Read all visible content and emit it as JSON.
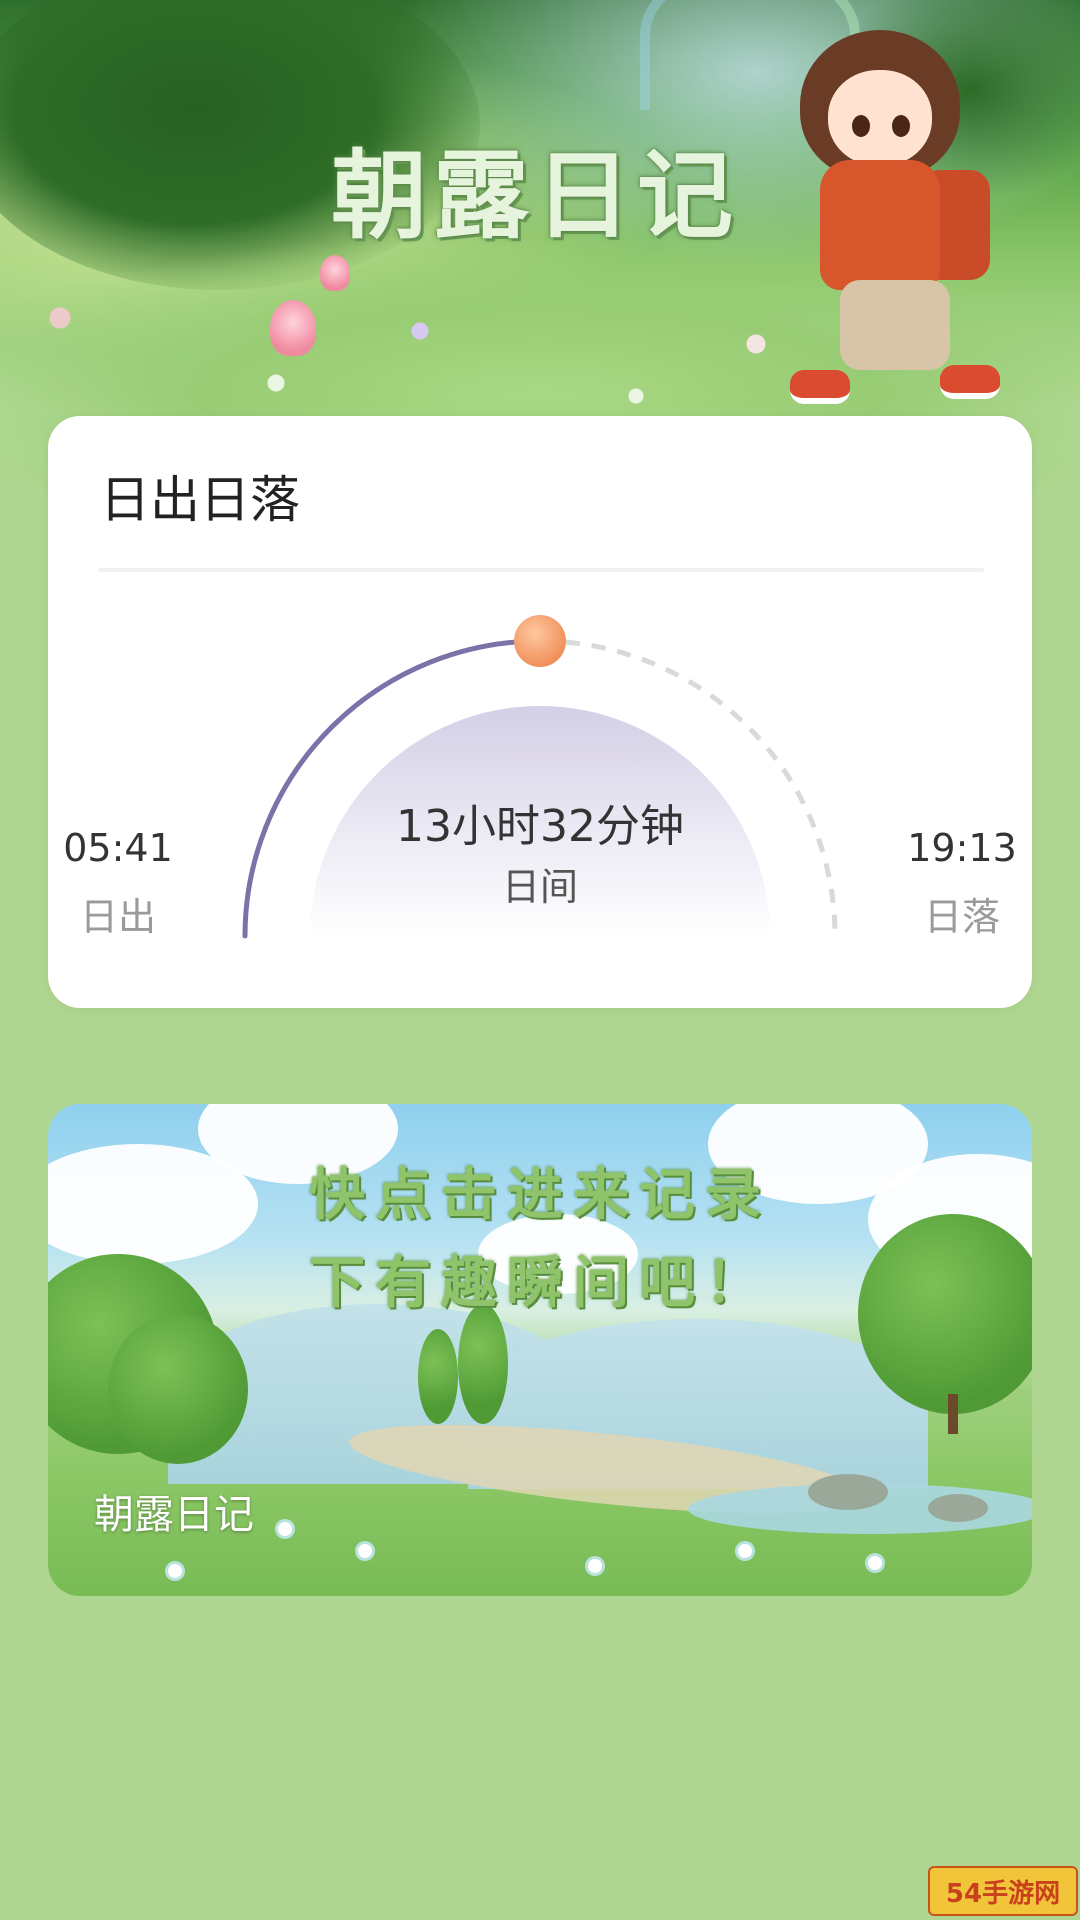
{
  "hero": {
    "title": "朝露日记"
  },
  "sun_card": {
    "title": "日出日落",
    "duration": "13小时32分钟",
    "duration_label": "日间",
    "sunrise_time": "05:41",
    "sunrise_label": "日出",
    "sunset_time": "19:13",
    "sunset_label": "日落",
    "day_progress": 0.5,
    "colors": {
      "arc_done": "#7a72a8",
      "arc_remaining": "#d9d9dc",
      "sun": "#f0955c",
      "dome_top": "#d4cfe6"
    }
  },
  "banner": {
    "headline_line1": "快点击进来记录",
    "headline_line2": "下有趣瞬间吧！",
    "brand": "朝露日记"
  },
  "watermark": {
    "text": "54手游网"
  },
  "colors": {
    "page_background": "#afd690",
    "card_background": "#ffffff"
  }
}
